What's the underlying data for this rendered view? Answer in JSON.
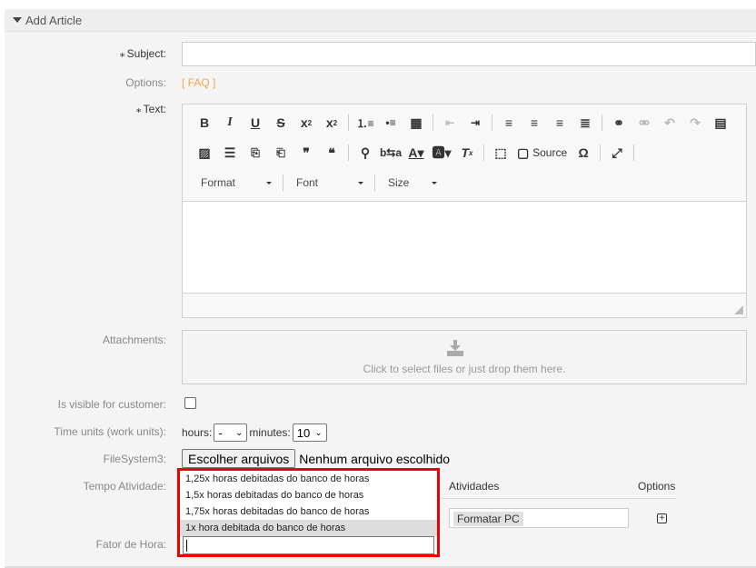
{
  "section": {
    "title": "Add Article"
  },
  "labels": {
    "subject": "Subject:",
    "options": "Options:",
    "text": "Text:",
    "attachments": "Attachments:",
    "visible": "Is visible for customer:",
    "time_units": "Time units (work units):",
    "filesystem": "FileSystem3:",
    "tempo": "Tempo Atividade:",
    "fator": "Fator de Hora:"
  },
  "required_mark": "⁎",
  "subject_value": "",
  "options_link": "[ FAQ ]",
  "editor": {
    "row1": [
      "B",
      "I",
      "U",
      "S",
      "x₂",
      "x²",
      "|",
      "1≡",
      "•≡",
      "▦",
      "|",
      "⇤",
      "⇥",
      "|",
      "≡",
      "≡",
      "≡",
      "≡",
      "|",
      "🔗",
      "⛓",
      "↶",
      "↷",
      "▤"
    ],
    "format_label": "Format",
    "font_label": "Font",
    "size_label": "Size",
    "source_label": "Source",
    "content": ""
  },
  "attachments": {
    "hint": "Click to select files or just drop them here."
  },
  "visible_checked": false,
  "time": {
    "hours_label": "hours:",
    "hours_value": "-",
    "minutes_label": "minutes:",
    "minutes_value": "10"
  },
  "filesystem": {
    "button": "Escolher arquivos",
    "status": "Nenhum arquivo escolhido"
  },
  "activities": {
    "header_activity": "Atividades",
    "header_options": "Options",
    "rows": [
      {
        "activity": "Formatar PC"
      }
    ]
  },
  "fator_dropdown": {
    "options": [
      "1,25x horas debitadas do banco de horas",
      "1,5x horas debitadas do banco de horas",
      "1,75x horas debitadas do banco de horas",
      "1x hora debitada do banco de horas"
    ],
    "highlighted_index": 3,
    "input_value": ""
  },
  "colors": {
    "highlight_border": "#e00000",
    "faq_link": "#f7a44c"
  }
}
